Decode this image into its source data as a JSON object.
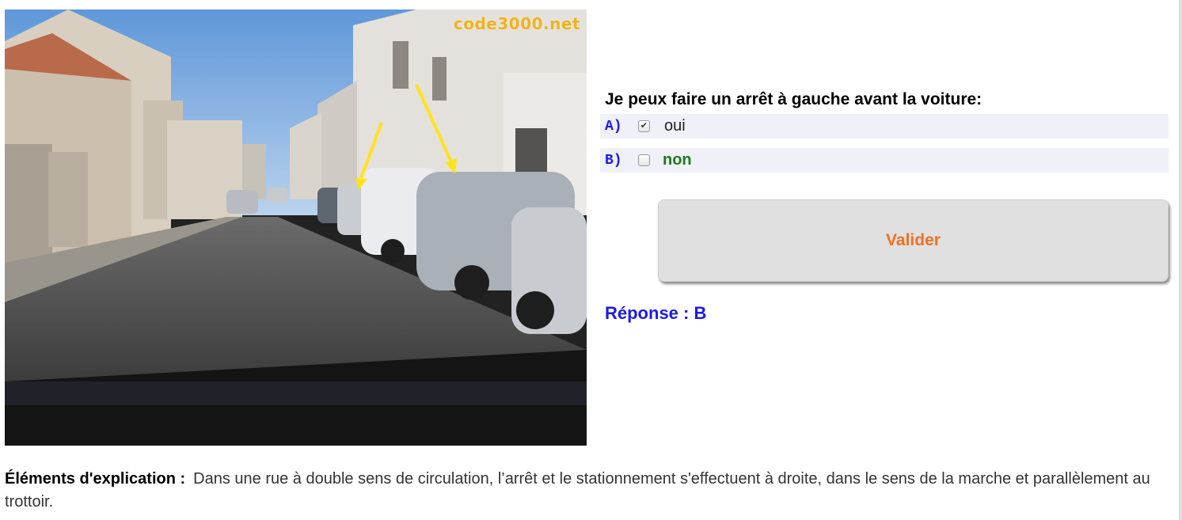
{
  "photo": {
    "watermark": "code3000.net",
    "icon": "street-photo"
  },
  "question": {
    "text": "Je peux faire un arrêt à gauche avant la voiture:"
  },
  "answers": [
    {
      "letter": "A)",
      "label": "oui",
      "checked": true,
      "color": "#222222"
    },
    {
      "letter": "B)",
      "label": "non",
      "checked": false,
      "color": "#1c7a1c"
    }
  ],
  "actions": {
    "validate_label": "Valider"
  },
  "result": {
    "text": "Réponse : B"
  },
  "explanation": {
    "label": "Éléments d'explication :",
    "text": "Dans une rue à double sens de circulation, l’arrêt et le stationnement s'effectuent à droite, dans le sens de la marche et parallèlement au trottoir."
  },
  "colors": {
    "letter_blue": "#1a1aee",
    "button_text": "#f07020",
    "answer_bg": "#f0f0f8"
  }
}
